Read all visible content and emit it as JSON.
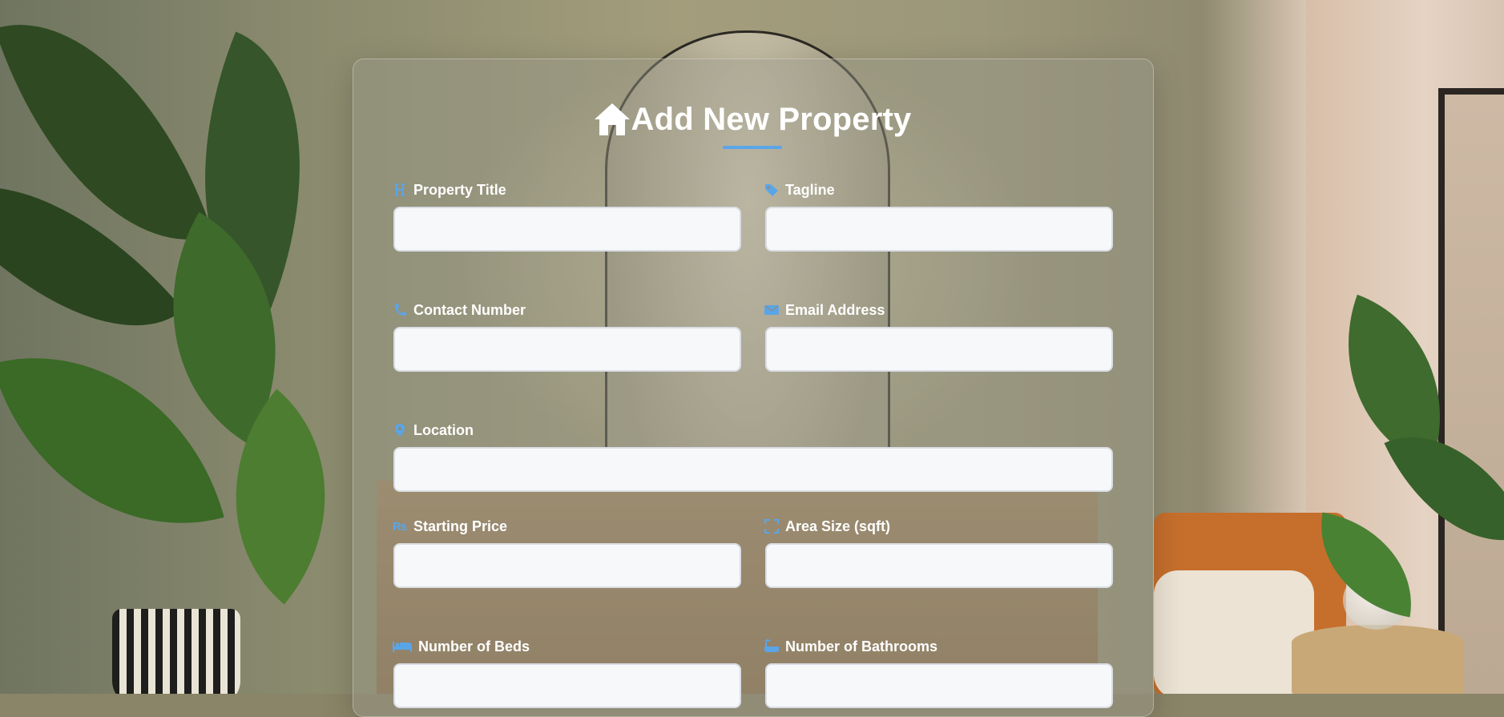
{
  "form": {
    "title": "Add New Property",
    "title_icon": "house-icon",
    "accent_color": "#5aa5e8",
    "fields": {
      "property_title": {
        "label": "Property Title",
        "icon": "heading-icon",
        "value": ""
      },
      "tagline": {
        "label": "Tagline",
        "icon": "tag-icon",
        "value": ""
      },
      "contact_number": {
        "label": "Contact Number",
        "icon": "phone-icon",
        "value": ""
      },
      "email_address": {
        "label": "Email Address",
        "icon": "envelope-icon",
        "value": ""
      },
      "location": {
        "label": "Location",
        "icon": "map-pin-icon",
        "value": ""
      },
      "starting_price": {
        "label": "Starting Price",
        "icon": "rupee-icon",
        "value": ""
      },
      "area_size": {
        "label": "Area Size (sqft)",
        "icon": "expand-icon",
        "value": ""
      },
      "number_of_beds": {
        "label": "Number of Beds",
        "icon": "bed-icon",
        "value": ""
      },
      "number_of_bathrooms": {
        "label": "Number of Bathrooms",
        "icon": "bath-icon",
        "value": ""
      }
    }
  }
}
